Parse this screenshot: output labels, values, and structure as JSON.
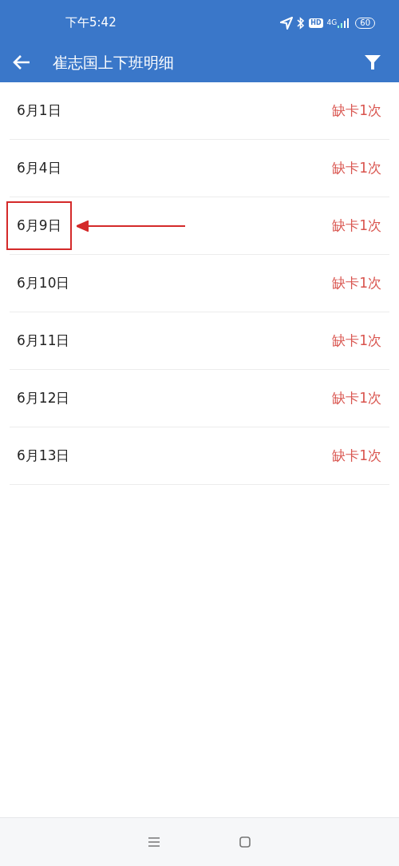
{
  "status_bar": {
    "time": "下午5:42",
    "hd": "HD",
    "network": "4G",
    "battery": "60"
  },
  "app_bar": {
    "title": "崔志国上下班明细"
  },
  "rows": [
    {
      "date": "6月1日",
      "status": "缺卡1次",
      "highlighted": false
    },
    {
      "date": "6月4日",
      "status": "缺卡1次",
      "highlighted": false
    },
    {
      "date": "6月9日",
      "status": "缺卡1次",
      "highlighted": true
    },
    {
      "date": "6月10日",
      "status": "缺卡1次",
      "highlighted": false
    },
    {
      "date": "6月11日",
      "status": "缺卡1次",
      "highlighted": false
    },
    {
      "date": "6月12日",
      "status": "缺卡1次",
      "highlighted": false
    },
    {
      "date": "6月13日",
      "status": "缺卡1次",
      "highlighted": false
    }
  ]
}
